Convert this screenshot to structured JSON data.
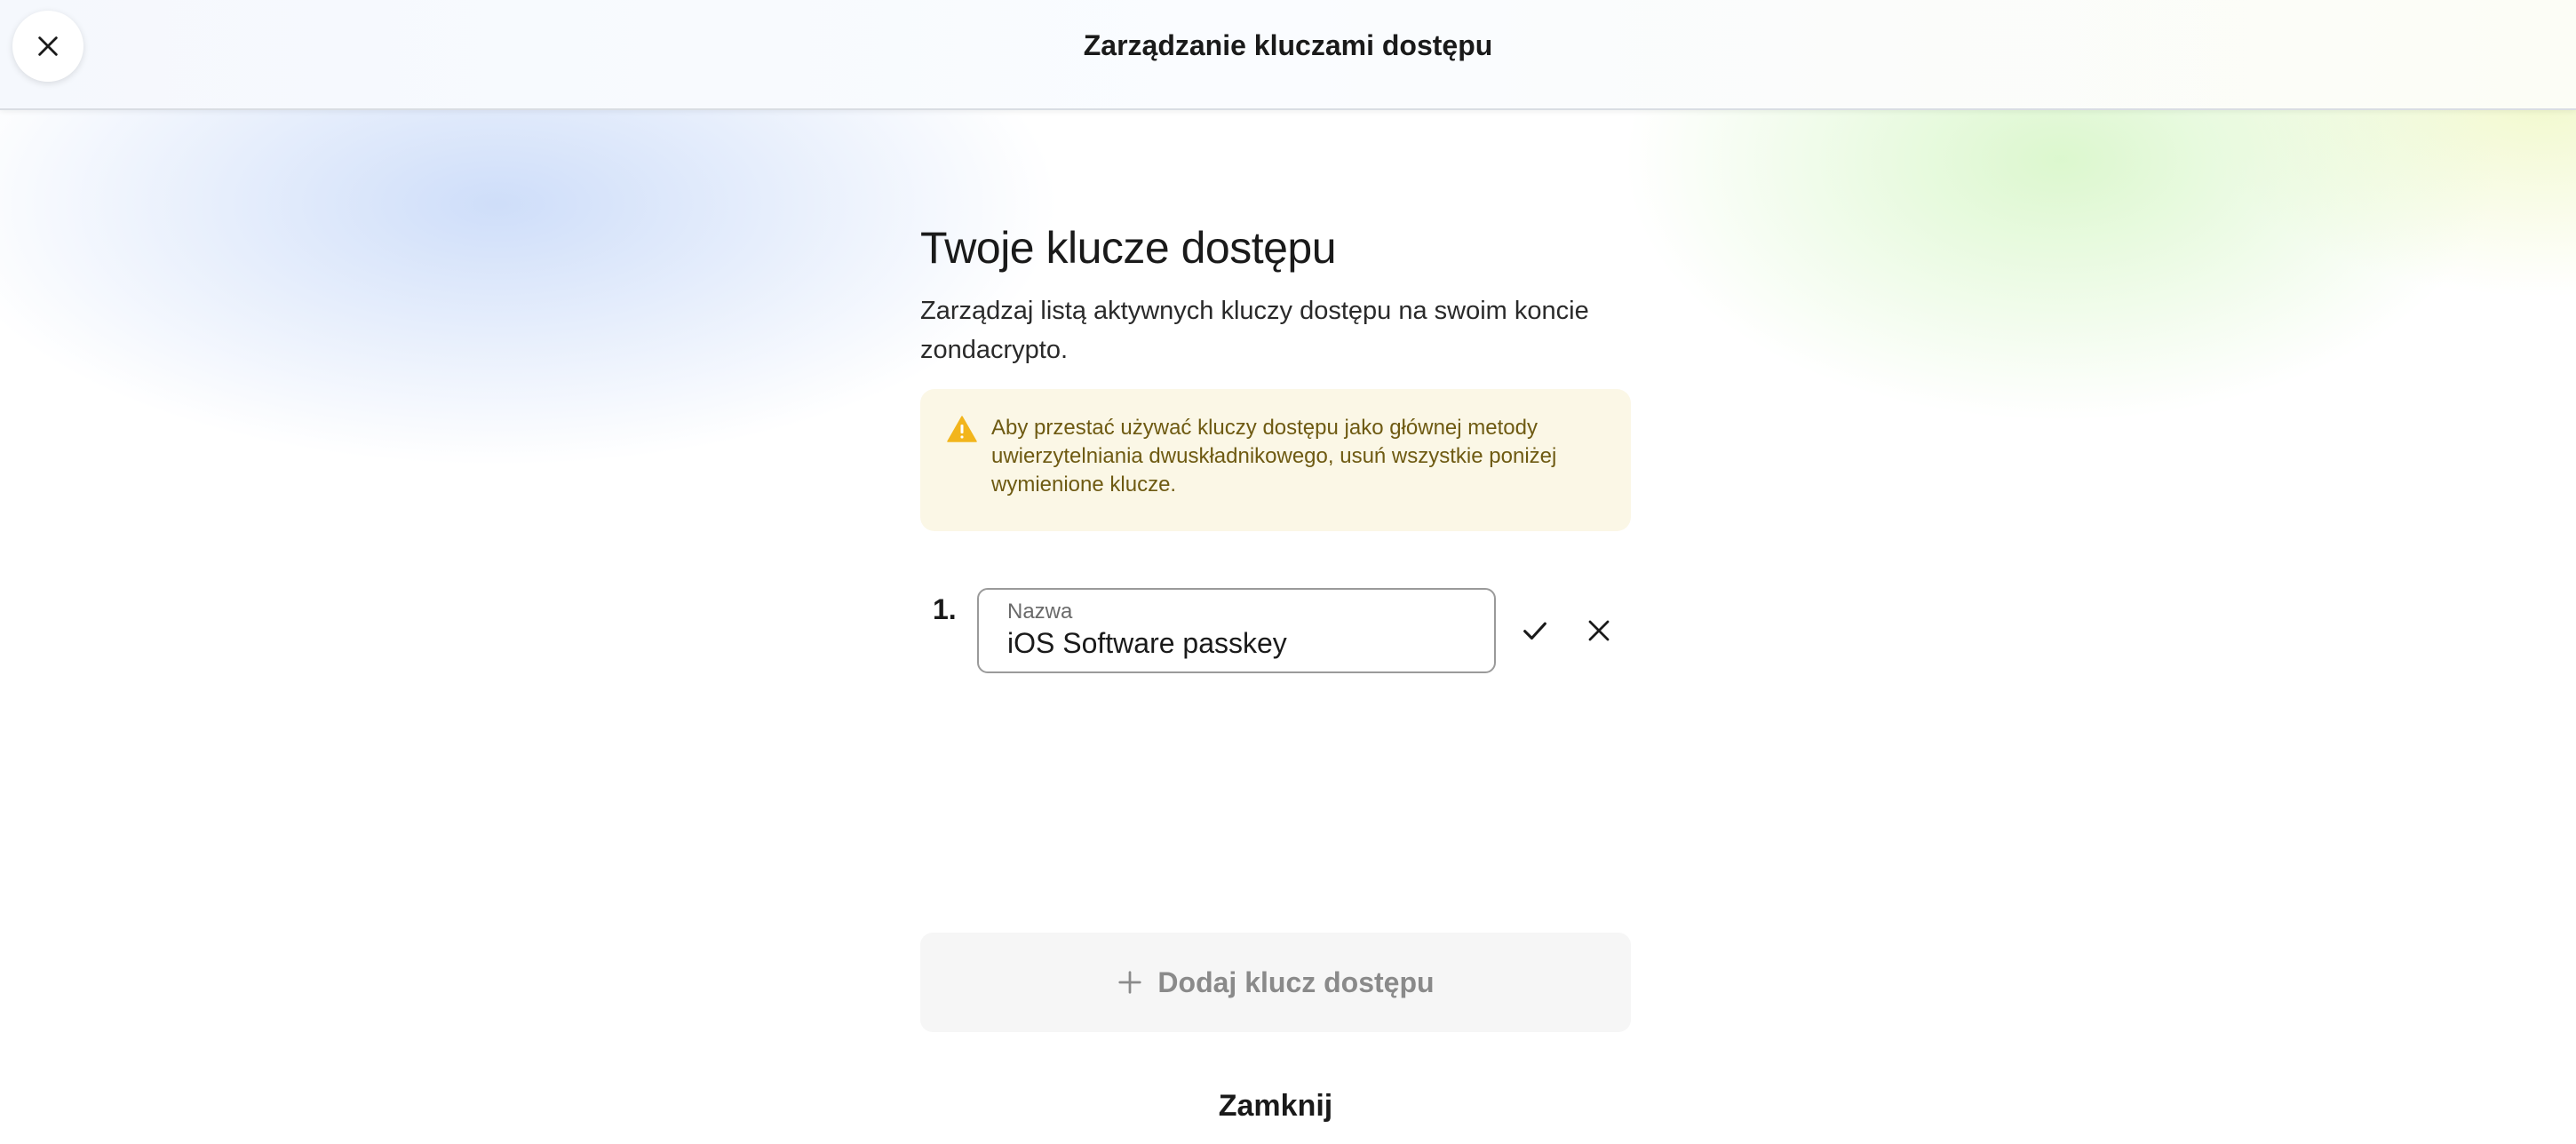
{
  "header": {
    "title": "Zarządzanie kluczami dostępu",
    "close_icon": "close-icon"
  },
  "main": {
    "title": "Twoje klucze dostępu",
    "description": "Zarządzaj listą aktywnych kluczy dostępu na swoim koncie zondacrypto.",
    "alert": {
      "icon": "warning-icon",
      "color": "#f2b51c",
      "text": "Aby przestać używać kluczy dostępu jako głównej metody uwierzytelniania dwuskładnikowego, usuń wszystkie poniżej wymienione klucze."
    },
    "passkeys": [
      {
        "number": "1.",
        "field_label": "Nazwa",
        "value": "iOS Software passkey",
        "confirm_icon": "check-icon",
        "cancel_icon": "close-icon"
      }
    ],
    "add_button": {
      "icon": "plus-icon",
      "label": "Dodaj klucz dostępu"
    },
    "close_label": "Zamknij"
  }
}
